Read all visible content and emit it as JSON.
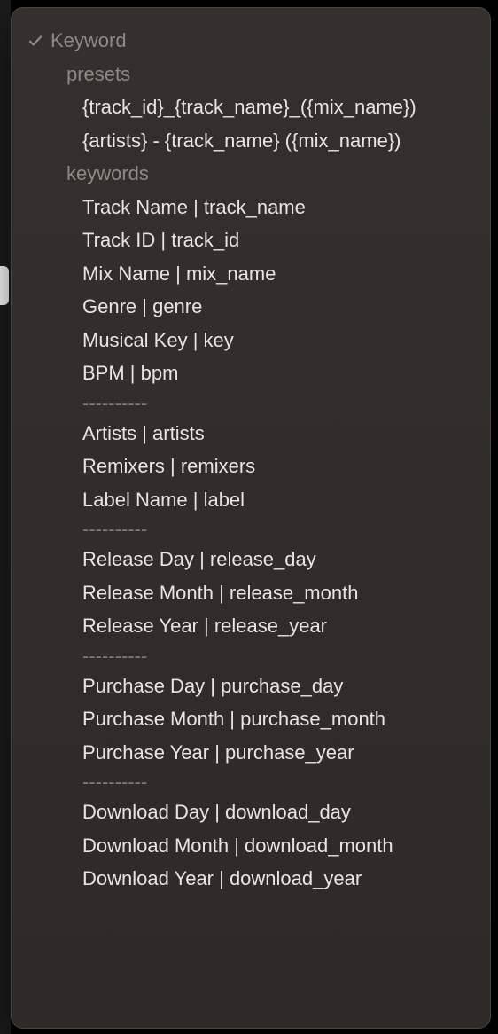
{
  "menu": {
    "title": "Keyword",
    "sections": {
      "presets": {
        "label": "presets",
        "items": [
          "{track_id}_{track_name}_({mix_name})",
          "{artists} - {track_name} ({mix_name})"
        ]
      },
      "keywords": {
        "label": "keywords",
        "groups": [
          [
            "Track Name | track_name",
            "Track ID | track_id",
            "Mix Name | mix_name",
            "Genre | genre",
            "Musical Key | key",
            "BPM | bpm"
          ],
          [
            "Artists | artists",
            "Remixers | remixers",
            "Label Name | label"
          ],
          [
            "Release Day | release_day",
            "Release Month | release_month",
            "Release Year | release_year"
          ],
          [
            "Purchase Day | purchase_day",
            "Purchase Month | purchase_month",
            "Purchase Year | purchase_year"
          ],
          [
            "Download Day | download_day",
            "Download Month | download_month",
            "Download Year | download_year"
          ]
        ]
      }
    },
    "divider_glyph": "----------"
  }
}
